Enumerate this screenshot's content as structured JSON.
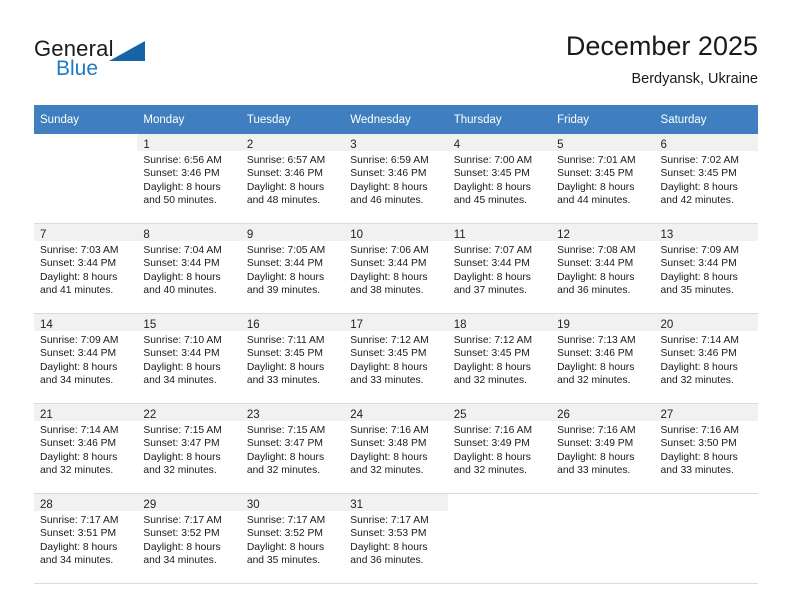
{
  "brand": {
    "general": "General",
    "blue": "Blue",
    "triangle_color": "#1763a8",
    "blue_color": "#1f7ac4"
  },
  "header": {
    "title": "December 2025",
    "subtitle": "Berdyansk, Ukraine"
  },
  "theme": {
    "header_row_bg": "#3f7fbf",
    "header_row_text": "#ffffff",
    "daynum_bg": "#f1f1f1",
    "grid_line": "#d2dce8"
  },
  "weekdays": [
    "Sunday",
    "Monday",
    "Tuesday",
    "Wednesday",
    "Thursday",
    "Friday",
    "Saturday"
  ],
  "weeks": [
    [
      {
        "day": ""
      },
      {
        "day": "1",
        "sunrise": "Sunrise: 6:56 AM",
        "sunset": "Sunset: 3:46 PM",
        "daylight1": "Daylight: 8 hours",
        "daylight2": "and 50 minutes."
      },
      {
        "day": "2",
        "sunrise": "Sunrise: 6:57 AM",
        "sunset": "Sunset: 3:46 PM",
        "daylight1": "Daylight: 8 hours",
        "daylight2": "and 48 minutes."
      },
      {
        "day": "3",
        "sunrise": "Sunrise: 6:59 AM",
        "sunset": "Sunset: 3:46 PM",
        "daylight1": "Daylight: 8 hours",
        "daylight2": "and 46 minutes."
      },
      {
        "day": "4",
        "sunrise": "Sunrise: 7:00 AM",
        "sunset": "Sunset: 3:45 PM",
        "daylight1": "Daylight: 8 hours",
        "daylight2": "and 45 minutes."
      },
      {
        "day": "5",
        "sunrise": "Sunrise: 7:01 AM",
        "sunset": "Sunset: 3:45 PM",
        "daylight1": "Daylight: 8 hours",
        "daylight2": "and 44 minutes."
      },
      {
        "day": "6",
        "sunrise": "Sunrise: 7:02 AM",
        "sunset": "Sunset: 3:45 PM",
        "daylight1": "Daylight: 8 hours",
        "daylight2": "and 42 minutes."
      }
    ],
    [
      {
        "day": "7",
        "sunrise": "Sunrise: 7:03 AM",
        "sunset": "Sunset: 3:44 PM",
        "daylight1": "Daylight: 8 hours",
        "daylight2": "and 41 minutes."
      },
      {
        "day": "8",
        "sunrise": "Sunrise: 7:04 AM",
        "sunset": "Sunset: 3:44 PM",
        "daylight1": "Daylight: 8 hours",
        "daylight2": "and 40 minutes."
      },
      {
        "day": "9",
        "sunrise": "Sunrise: 7:05 AM",
        "sunset": "Sunset: 3:44 PM",
        "daylight1": "Daylight: 8 hours",
        "daylight2": "and 39 minutes."
      },
      {
        "day": "10",
        "sunrise": "Sunrise: 7:06 AM",
        "sunset": "Sunset: 3:44 PM",
        "daylight1": "Daylight: 8 hours",
        "daylight2": "and 38 minutes."
      },
      {
        "day": "11",
        "sunrise": "Sunrise: 7:07 AM",
        "sunset": "Sunset: 3:44 PM",
        "daylight1": "Daylight: 8 hours",
        "daylight2": "and 37 minutes."
      },
      {
        "day": "12",
        "sunrise": "Sunrise: 7:08 AM",
        "sunset": "Sunset: 3:44 PM",
        "daylight1": "Daylight: 8 hours",
        "daylight2": "and 36 minutes."
      },
      {
        "day": "13",
        "sunrise": "Sunrise: 7:09 AM",
        "sunset": "Sunset: 3:44 PM",
        "daylight1": "Daylight: 8 hours",
        "daylight2": "and 35 minutes."
      }
    ],
    [
      {
        "day": "14",
        "sunrise": "Sunrise: 7:09 AM",
        "sunset": "Sunset: 3:44 PM",
        "daylight1": "Daylight: 8 hours",
        "daylight2": "and 34 minutes."
      },
      {
        "day": "15",
        "sunrise": "Sunrise: 7:10 AM",
        "sunset": "Sunset: 3:44 PM",
        "daylight1": "Daylight: 8 hours",
        "daylight2": "and 34 minutes."
      },
      {
        "day": "16",
        "sunrise": "Sunrise: 7:11 AM",
        "sunset": "Sunset: 3:45 PM",
        "daylight1": "Daylight: 8 hours",
        "daylight2": "and 33 minutes."
      },
      {
        "day": "17",
        "sunrise": "Sunrise: 7:12 AM",
        "sunset": "Sunset: 3:45 PM",
        "daylight1": "Daylight: 8 hours",
        "daylight2": "and 33 minutes."
      },
      {
        "day": "18",
        "sunrise": "Sunrise: 7:12 AM",
        "sunset": "Sunset: 3:45 PM",
        "daylight1": "Daylight: 8 hours",
        "daylight2": "and 32 minutes."
      },
      {
        "day": "19",
        "sunrise": "Sunrise: 7:13 AM",
        "sunset": "Sunset: 3:46 PM",
        "daylight1": "Daylight: 8 hours",
        "daylight2": "and 32 minutes."
      },
      {
        "day": "20",
        "sunrise": "Sunrise: 7:14 AM",
        "sunset": "Sunset: 3:46 PM",
        "daylight1": "Daylight: 8 hours",
        "daylight2": "and 32 minutes."
      }
    ],
    [
      {
        "day": "21",
        "sunrise": "Sunrise: 7:14 AM",
        "sunset": "Sunset: 3:46 PM",
        "daylight1": "Daylight: 8 hours",
        "daylight2": "and 32 minutes."
      },
      {
        "day": "22",
        "sunrise": "Sunrise: 7:15 AM",
        "sunset": "Sunset: 3:47 PM",
        "daylight1": "Daylight: 8 hours",
        "daylight2": "and 32 minutes."
      },
      {
        "day": "23",
        "sunrise": "Sunrise: 7:15 AM",
        "sunset": "Sunset: 3:47 PM",
        "daylight1": "Daylight: 8 hours",
        "daylight2": "and 32 minutes."
      },
      {
        "day": "24",
        "sunrise": "Sunrise: 7:16 AM",
        "sunset": "Sunset: 3:48 PM",
        "daylight1": "Daylight: 8 hours",
        "daylight2": "and 32 minutes."
      },
      {
        "day": "25",
        "sunrise": "Sunrise: 7:16 AM",
        "sunset": "Sunset: 3:49 PM",
        "daylight1": "Daylight: 8 hours",
        "daylight2": "and 32 minutes."
      },
      {
        "day": "26",
        "sunrise": "Sunrise: 7:16 AM",
        "sunset": "Sunset: 3:49 PM",
        "daylight1": "Daylight: 8 hours",
        "daylight2": "and 33 minutes."
      },
      {
        "day": "27",
        "sunrise": "Sunrise: 7:16 AM",
        "sunset": "Sunset: 3:50 PM",
        "daylight1": "Daylight: 8 hours",
        "daylight2": "and 33 minutes."
      }
    ],
    [
      {
        "day": "28",
        "sunrise": "Sunrise: 7:17 AM",
        "sunset": "Sunset: 3:51 PM",
        "daylight1": "Daylight: 8 hours",
        "daylight2": "and 34 minutes."
      },
      {
        "day": "29",
        "sunrise": "Sunrise: 7:17 AM",
        "sunset": "Sunset: 3:52 PM",
        "daylight1": "Daylight: 8 hours",
        "daylight2": "and 34 minutes."
      },
      {
        "day": "30",
        "sunrise": "Sunrise: 7:17 AM",
        "sunset": "Sunset: 3:52 PM",
        "daylight1": "Daylight: 8 hours",
        "daylight2": "and 35 minutes."
      },
      {
        "day": "31",
        "sunrise": "Sunrise: 7:17 AM",
        "sunset": "Sunset: 3:53 PM",
        "daylight1": "Daylight: 8 hours",
        "daylight2": "and 36 minutes."
      },
      {
        "day": ""
      },
      {
        "day": ""
      },
      {
        "day": ""
      }
    ]
  ]
}
